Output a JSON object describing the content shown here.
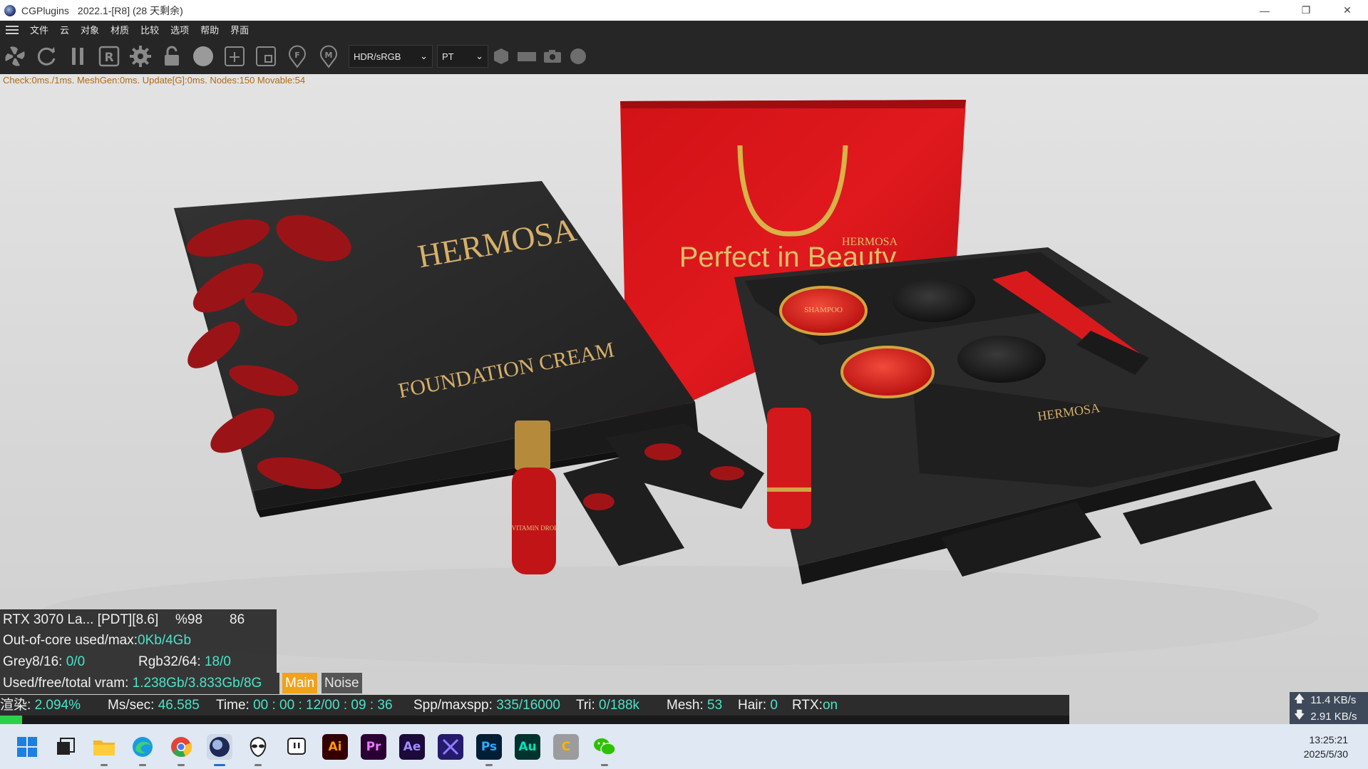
{
  "window": {
    "app_name": "CGPlugins",
    "version_text": "2022.1-[R8] (28 天剩余)",
    "minimize": "—",
    "restore": "❐",
    "close": "✕"
  },
  "menu": [
    "文件",
    "云",
    "对象",
    "材质",
    "比较",
    "选项",
    "帮助",
    "界面"
  ],
  "toolbar": {
    "icons": [
      "fan-icon",
      "refresh-icon",
      "pause-icon",
      "r-icon",
      "gear-icon",
      "lock-icon",
      "sphere-icon",
      "add-box-icon",
      "region-icon",
      "focus-pin-icon",
      "material-pin-icon"
    ],
    "color_mode": "HDR/sRGB",
    "kernel": "PT",
    "extra_icons": [
      "hexagon-icon",
      "film-icon",
      "camera-icon",
      "circle-icon"
    ]
  },
  "status_line": "Check:0ms./1ms. MeshGen:0ms. Update[G]:0ms. Nodes:150 Movable:54",
  "scene": {
    "brand": "HERMOSA",
    "box_label": "FOUNDATION CREAM",
    "bag_slogan": "Perfect in Beauty",
    "jar_label": "SHAMPOO",
    "bottle_label": "VITAMIN DROP"
  },
  "hud": {
    "gpu_name": "RTX 3070 La... [PDT][8.6]",
    "gpu_percent": "%98",
    "gpu_temp": "86",
    "out_of_core_label": "Out-of-core used/max:",
    "out_of_core_value": "0Kb/4Gb",
    "grey_label": "Grey8/16: ",
    "grey_value": "0/0",
    "rgb_label": "Rgb32/64: ",
    "rgb_value": "18/0",
    "vram_label": "Used/free/total vram: ",
    "vram_value": "1.238Gb/3.833Gb/8G",
    "tab_main": "Main",
    "tab_noise": "Noise"
  },
  "render_status": {
    "render_label": "渲染:",
    "render_percent": "2.094%",
    "ms_label": "Ms/sec:",
    "ms_value": "46.585",
    "time_label": "Time:",
    "time_value": "00 : 00 : 12/00 : 09 : 36",
    "spp_label": "Spp/maxspp:",
    "spp_value": "335/16000",
    "tri_label": "Tri:",
    "tri_value": "0/188k",
    "mesh_label": "Mesh:",
    "mesh_value": "53",
    "hair_label": "Hair:",
    "hair_value": "0",
    "rtx_label": "RTX:",
    "rtx_value": "on",
    "progress_fraction": 0.021
  },
  "network": {
    "upload": "11.4 KB/s",
    "download": "2.91 KB/s"
  },
  "taskbar": {
    "apps": [
      "windows-start",
      "task-view",
      "file-explorer",
      "edge",
      "chrome",
      "cinema4d",
      "alien-app",
      "twitch",
      "illustrator",
      "premiere",
      "after-effects",
      "vs-app",
      "photoshop",
      "audition",
      "c-app",
      "wechat"
    ],
    "ai": "Ai",
    "pr": "Pr",
    "ae": "Ae",
    "ps": "Ps",
    "au": "Au",
    "c": "C",
    "time": "13:25:21",
    "date": "2025/5/30"
  }
}
